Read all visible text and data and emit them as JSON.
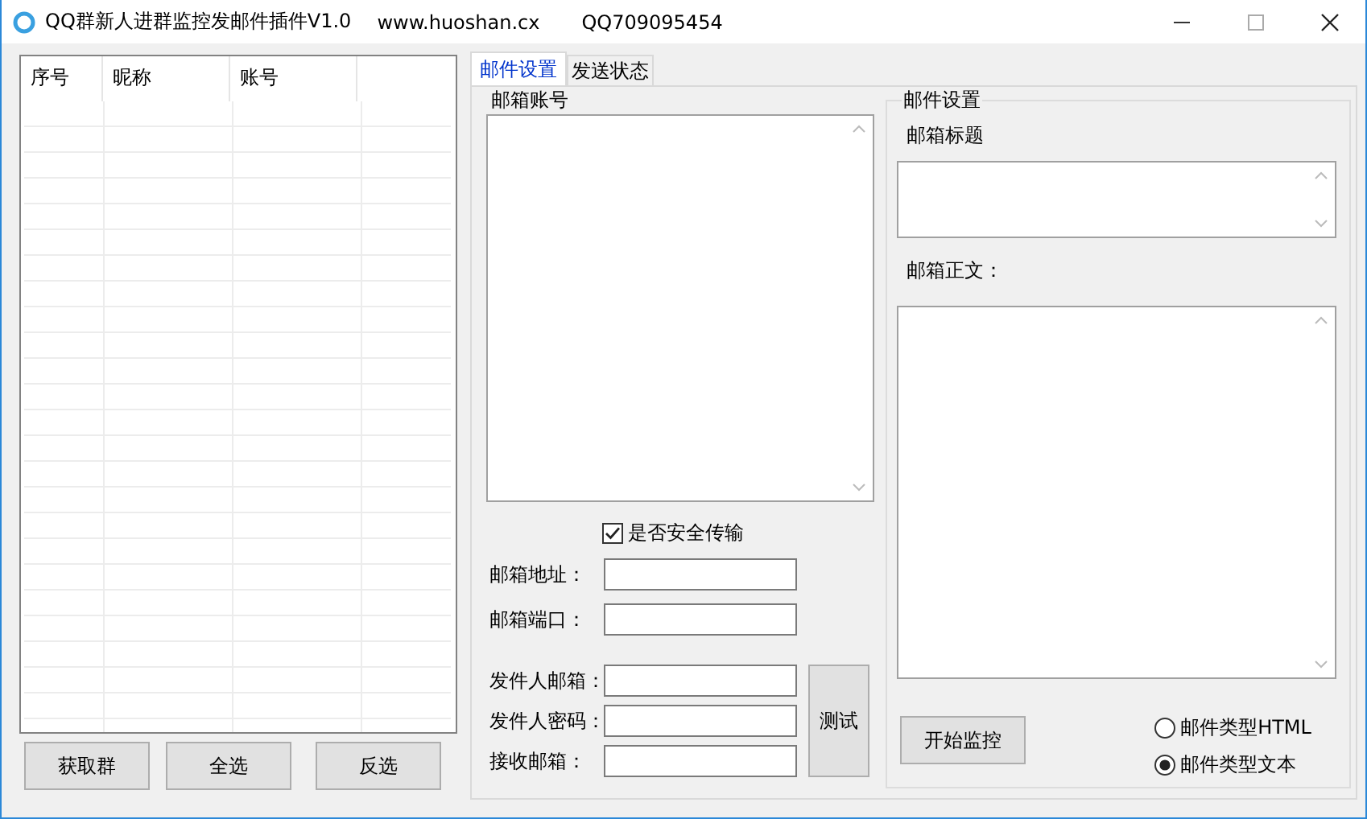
{
  "window": {
    "title": "QQ群新人进群监控发邮件插件V1.0",
    "website": "www.huoshan.cx",
    "qq": "QQ709095454"
  },
  "table": {
    "columns": [
      "序号",
      "昵称",
      "账号"
    ]
  },
  "buttons": [
    "获取群",
    "全选",
    "反选"
  ],
  "tabs": [
    {
      "label": "邮件设置",
      "selected": true
    },
    {
      "label": "发送状态",
      "selected": false
    }
  ],
  "mail_account": {
    "title": "邮箱账号",
    "secure": {
      "label": "是否安全传输",
      "checked": true
    },
    "server_fields": [
      {
        "label": "邮箱地址："
      },
      {
        "label": "邮箱端口："
      }
    ],
    "sender_fields": [
      {
        "label": "发件人邮箱："
      },
      {
        "label": "发件人密码："
      },
      {
        "label": "接收邮箱："
      }
    ],
    "test_button": "测试"
  },
  "mail_settings": {
    "title": "邮件设置",
    "subject_label": "邮箱标题",
    "body_label": "邮箱正文：",
    "start_button": "开始监控",
    "formats": [
      {
        "label": "邮件类型HTML",
        "selected": false
      },
      {
        "label": "邮件类型文本",
        "selected": true
      }
    ]
  }
}
